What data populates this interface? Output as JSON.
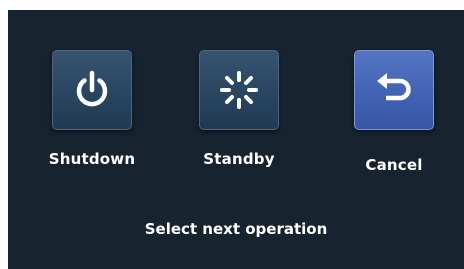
{
  "dialog": {
    "options": [
      {
        "id": "shutdown",
        "label": "Shutdown",
        "icon": "power-icon",
        "selected": false
      },
      {
        "id": "standby",
        "label": "Standby",
        "icon": "standby-spinner-icon",
        "selected": false
      },
      {
        "id": "cancel",
        "label": "Cancel",
        "icon": "return-arrow-icon",
        "selected": true
      }
    ],
    "prompt": "Select next operation"
  },
  "colors": {
    "background": "#17232f",
    "tile": "#294560",
    "tile_selected": "#4263b4",
    "text": "#ffffff"
  }
}
